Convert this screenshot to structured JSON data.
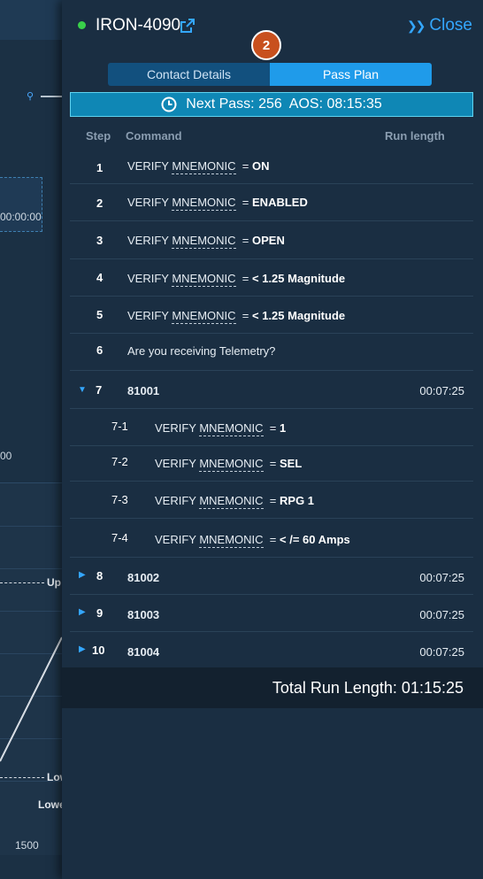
{
  "background": {
    "time_text": "00:00:00",
    "zero_text": "00",
    "up_label": "Up",
    "low_label": "Low",
    "lower_label": "Lowe",
    "axis_1500": "1500"
  },
  "header": {
    "title": "IRON-4090",
    "close_label": "Close",
    "badge": "2"
  },
  "tabs": [
    {
      "label": "Contact Details"
    },
    {
      "label": "Pass Plan"
    }
  ],
  "next_pass": "Next Pass: 256  AOS: 08:15:35",
  "columns": {
    "step": "Step",
    "command": "Command",
    "run_length": "Run length"
  },
  "rows": [
    {
      "step": "1",
      "verb": "VERIFY",
      "mnemonic": "MNEMONIC",
      "op": "=",
      "value": "ON"
    },
    {
      "step": "2",
      "verb": "VERIFY",
      "mnemonic": "MNEMONIC",
      "op": "=",
      "value": "ENABLED"
    },
    {
      "step": "3",
      "verb": "VERIFY",
      "mnemonic": "MNEMONIC",
      "op": "=",
      "value": "OPEN"
    },
    {
      "step": "4",
      "verb": "VERIFY",
      "mnemonic": "MNEMONIC",
      "op": "=",
      "value": "< 1.25 Magnitude"
    },
    {
      "step": "5",
      "verb": "VERIFY",
      "mnemonic": "MNEMONIC",
      "op": "=",
      "value": "< 1.25 Magnitude"
    },
    {
      "step": "6",
      "text": "Are you receiving Telemetry?"
    },
    {
      "step": "7",
      "command": "81001",
      "run_length": "00:07:25"
    },
    {
      "step": "7-1",
      "verb": "VERIFY",
      "mnemonic": "MNEMONIC",
      "op": "=",
      "value": "1"
    },
    {
      "step": "7-2",
      "verb": "VERIFY",
      "mnemonic": "MNEMONIC",
      "op": "=",
      "value": "SEL"
    },
    {
      "step": "7-3",
      "verb": "VERIFY",
      "mnemonic": "MNEMONIC",
      "op": "=",
      "value": "RPG 1"
    },
    {
      "step": "7-4",
      "verb": "VERIFY",
      "mnemonic": "MNEMONIC",
      "op": "=",
      "value": "< /= 60 Amps"
    },
    {
      "step": "8",
      "command": "81002",
      "run_length": "00:07:25"
    },
    {
      "step": "9",
      "command": "81003",
      "run_length": "00:07:25"
    },
    {
      "step": "10",
      "command": "81004",
      "run_length": "00:07:25"
    }
  ],
  "total_label": "Total Run Length: 01:15:25",
  "colors": {
    "accent": "#34a7ff",
    "status_online": "#39d04a",
    "badge": "#c8501e",
    "banner": "#0f87b5"
  }
}
